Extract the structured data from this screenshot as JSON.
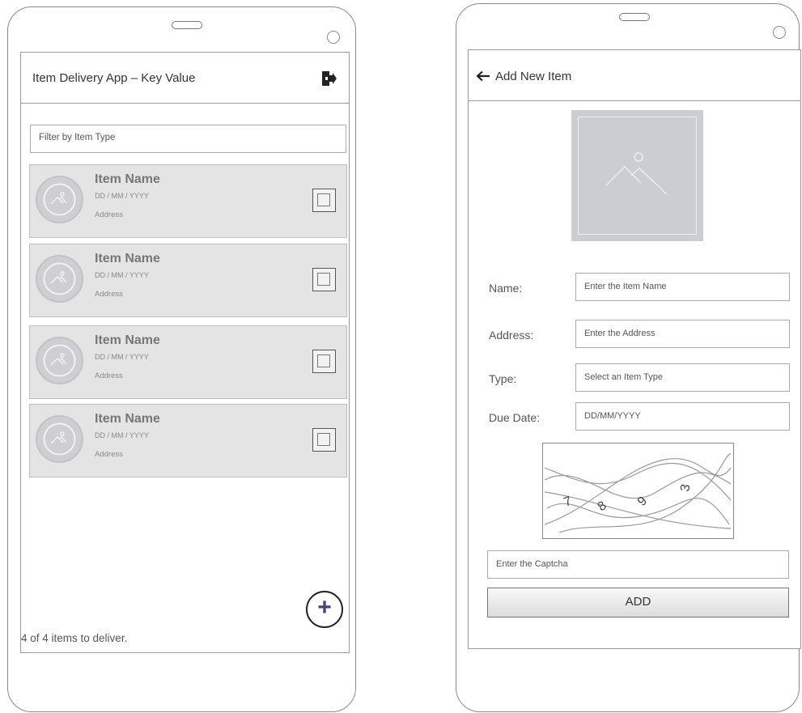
{
  "list_screen": {
    "title": "Item Delivery App – Key Value",
    "logout_icon": "logout-icon",
    "filter_placeholder": "Filter by Item Type",
    "items": [
      {
        "name": "Item Name",
        "date": "DD / MM / YYYY",
        "address": "Address"
      },
      {
        "name": "Item Name",
        "date": "DD / MM / YYYY",
        "address": "Address"
      },
      {
        "name": "Item Name",
        "date": "DD / MM / YYYY",
        "address": "Address"
      },
      {
        "name": "Item Name",
        "date": "DD / MM / YYYY",
        "address": "Address"
      }
    ],
    "footer_count": "4 of 4 items to deliver.",
    "fab_label": "+"
  },
  "add_screen": {
    "back_icon": "back-arrow-icon",
    "title": "Add New Item",
    "image_icon": "image-placeholder-icon",
    "fields": {
      "name_label": "Name:",
      "name_placeholder": "Enter the Item Name",
      "address_label": "Address:",
      "address_placeholder": "Enter the Address",
      "type_label": "Type:",
      "type_placeholder": "Select an Item Type",
      "due_label": "Due Date:",
      "due_placeholder": "DD/MM/YYYY"
    },
    "captcha_digits": [
      "7",
      "8",
      "9",
      "3"
    ],
    "captcha_placeholder": "Enter the Captcha",
    "add_button": "ADD"
  },
  "colors": {
    "card_bg": "#e4e4e4",
    "fab_plus": "#4a3f78",
    "image_placeholder": "#cbcdd3"
  }
}
